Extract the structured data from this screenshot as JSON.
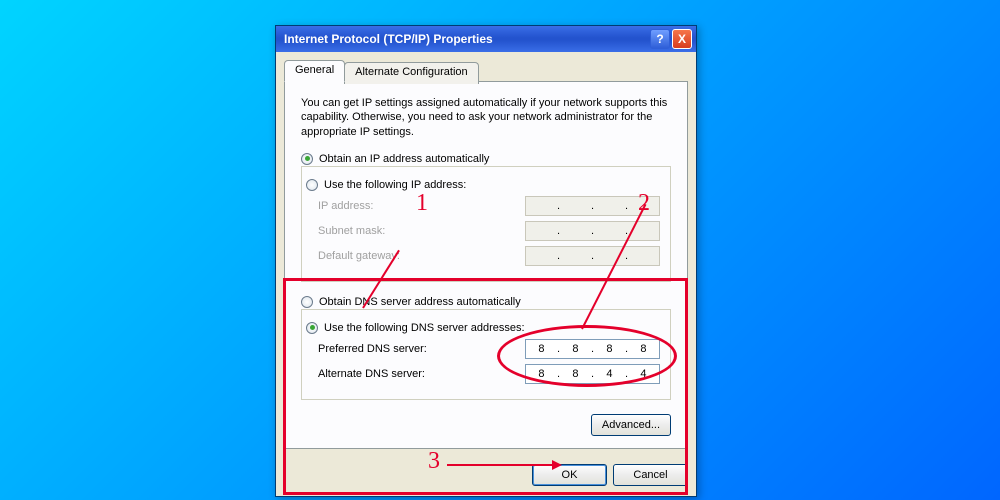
{
  "title": "Internet Protocol (TCP/IP) Properties",
  "tabs": {
    "general": "General",
    "alt": "Alternate Configuration"
  },
  "desc": "You can get IP settings assigned automatically if your network supports this capability. Otherwise, you need to ask your network administrator for the appropriate IP settings.",
  "ip": {
    "auto": "Obtain an IP address automatically",
    "manual": "Use the following IP address:",
    "addr_label": "IP address:",
    "mask_label": "Subnet mask:",
    "gw_label": "Default gateway:"
  },
  "dns": {
    "auto": "Obtain DNS server address automatically",
    "manual": "Use the following DNS server addresses:",
    "pref_label": "Preferred DNS server:",
    "alt_label": "Alternate DNS server:",
    "pref": [
      "8",
      "8",
      "8",
      "8"
    ],
    "alt": [
      "8",
      "8",
      "4",
      "4"
    ]
  },
  "buttons": {
    "advanced": "Advanced...",
    "ok": "OK",
    "cancel": "Cancel"
  },
  "icons": {
    "help": "?",
    "close": "X"
  },
  "annotations": {
    "1": "1",
    "2": "2",
    "3": "3"
  }
}
